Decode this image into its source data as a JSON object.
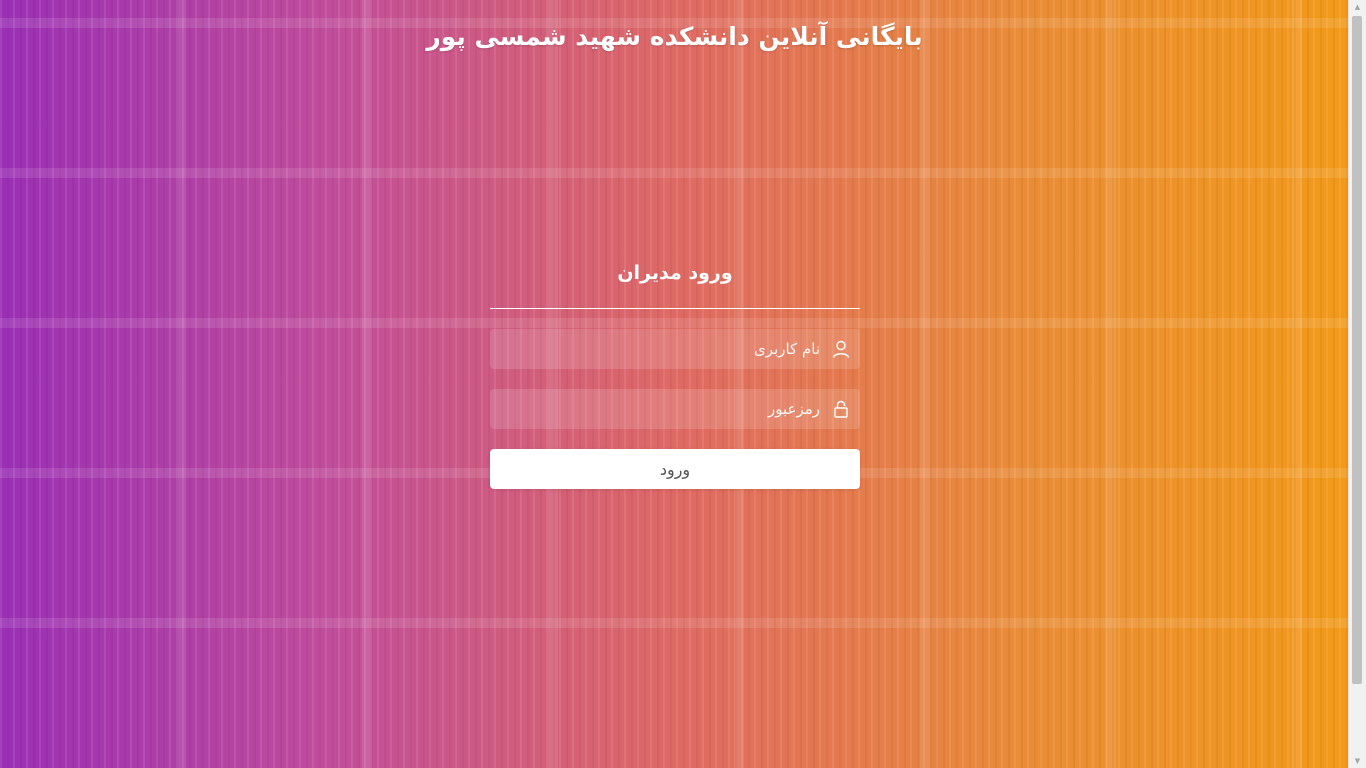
{
  "header": {
    "title": "بایگانی آنلاین دانشکده شهید شمسی پور"
  },
  "login": {
    "heading": "ورود مدیران",
    "username": {
      "placeholder": "نام کاربری",
      "value": "",
      "icon": "user-icon"
    },
    "password": {
      "placeholder": "رمزعبور",
      "value": "",
      "icon": "lock-icon"
    },
    "submit_label": "ورود"
  },
  "theme": {
    "gradient_start": "#9b2fb5",
    "gradient_end": "#f39a17",
    "text_color": "#ffffff",
    "button_bg": "#ffffff",
    "button_text": "#555555"
  }
}
